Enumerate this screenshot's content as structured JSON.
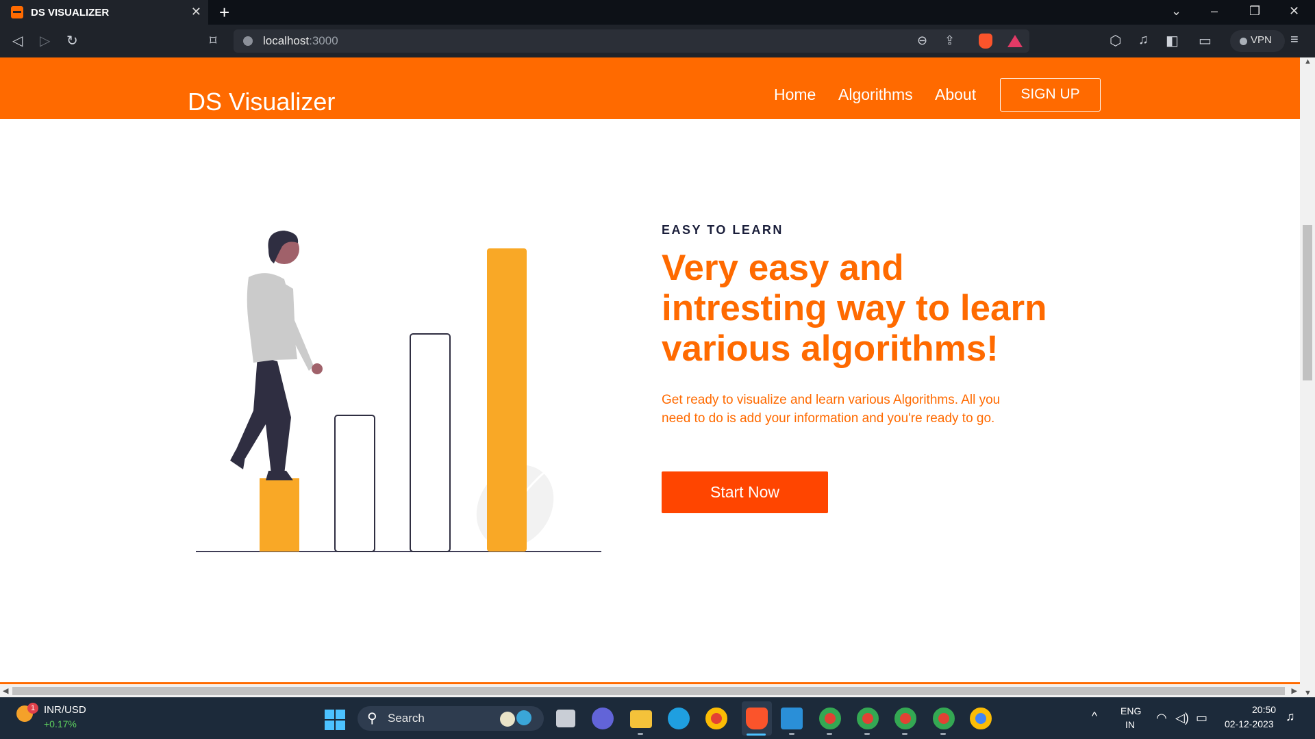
{
  "browser": {
    "tab_title": "DS VISUALIZER",
    "tab_close": "✕",
    "new_tab": "+",
    "url_host": "localhost",
    "url_port": ":3000",
    "vpn_label": "VPN",
    "controls": {
      "tabs_menu": "⌄",
      "minimize": "–",
      "restore": "❐",
      "close": "✕"
    }
  },
  "site": {
    "brand": "DS Visualizer",
    "nav": [
      {
        "label": "Home"
      },
      {
        "label": "Algorithms"
      },
      {
        "label": "About"
      }
    ],
    "signup_label": "SIGN UP"
  },
  "hero": {
    "eyebrow": "EASY TO LEARN",
    "headline": "Very easy and intresting way to learn various algorithms!",
    "subtext": "Get ready to visualize and learn various Algorithms. All you need to do is add your information and you're ready to go.",
    "cta_label": "Start Now"
  },
  "colors": {
    "accent": "#ff6a00",
    "cta": "#ff4500",
    "illustration_bar": "#f9a826",
    "dark": "#2f2e41"
  },
  "taskbar": {
    "ticker_badge": "1",
    "ticker_pair": "INR/USD",
    "ticker_change": "+0.17%",
    "search_label": "Search",
    "language_line1": "ENG",
    "language_line2": "IN",
    "time": "20:50",
    "date": "02-12-2023",
    "tray_caret": "^"
  }
}
